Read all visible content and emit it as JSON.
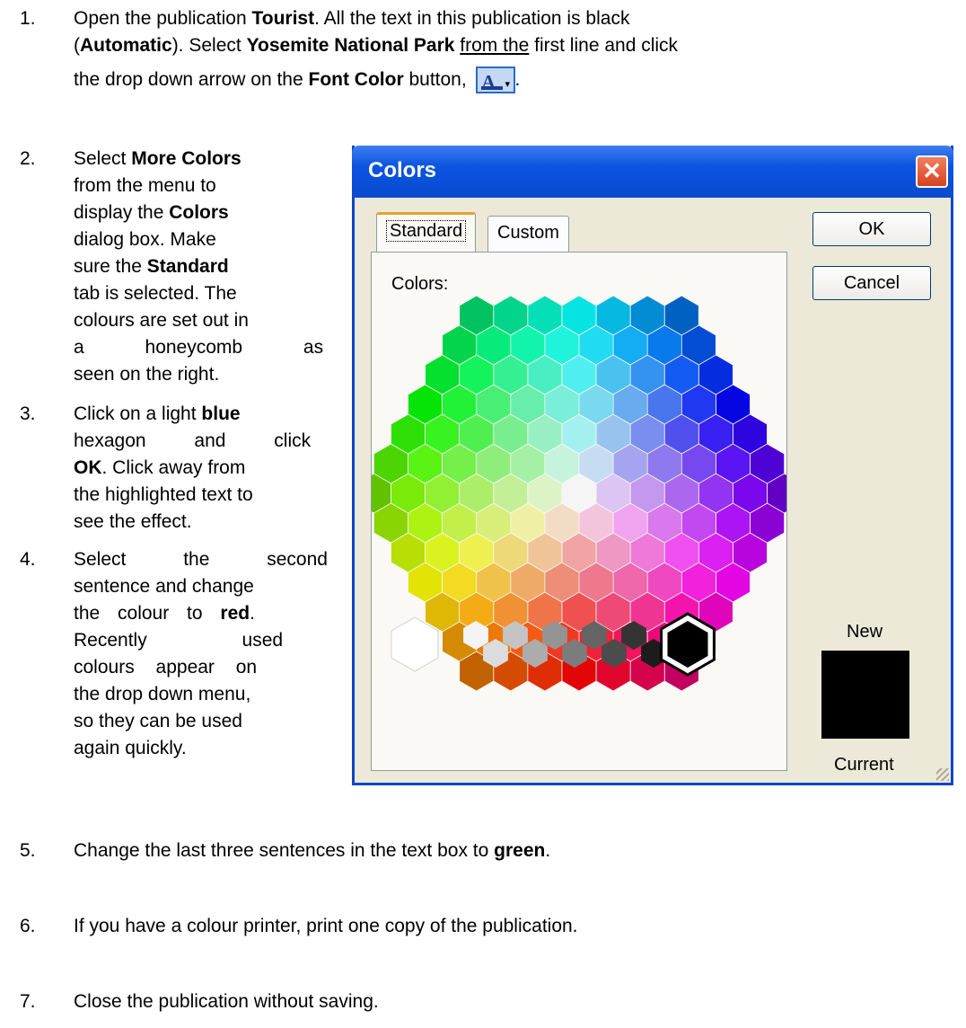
{
  "steps": [
    {
      "num": "1.",
      "line1_pre": "Open the publication ",
      "line1_b1": "Tourist",
      "line1_post": ". All the text in this publication is black",
      "line2_pre": "(",
      "line2_b1": "Automatic",
      "line2_mid": "). Select ",
      "line2_b2": "Yosemite National Park",
      "line2_u": "from the",
      "line2_post": " first line and click",
      "line3_pre": "the drop down arrow on the ",
      "line3_b1": "Font Color",
      "line3_post": " button,",
      "line3_end": "."
    },
    {
      "num": "2.",
      "lines": [
        "Select ",
        "More Colors",
        "from the menu to",
        "display the ",
        "Colors",
        "dialog box. Make",
        "sure the ",
        "Standard",
        "tab is selected. The",
        "colours are set out in",
        "a honeycomb as",
        "seen on the right."
      ]
    },
    {
      "num": "3.",
      "lines": [
        "Click on a light ",
        "blue",
        "hexagon and click",
        "OK",
        ". Click away from",
        "the highlighted text to",
        "see the effect."
      ]
    },
    {
      "num": "4.",
      "lines": [
        "Select the second",
        "sentence and change",
        "the colour to ",
        "red",
        ".",
        "Recently used",
        "colours appear on",
        "the drop down menu,",
        "so they can be used",
        "again quickly."
      ]
    },
    {
      "num": "5.",
      "pre": "Change the last three sentences in the text box to ",
      "b": "green",
      "post": "."
    },
    {
      "num": "6.",
      "text": "If you have a colour printer, print one copy of the publication."
    },
    {
      "num": "7.",
      "text": "Close the publication without saving."
    }
  ],
  "font_color_button": {
    "glyph": "A",
    "arrow": "▾",
    "icon": "font-color-icon"
  },
  "dialog": {
    "title": "Colors",
    "close_glyph": "✕",
    "tabs": [
      "Standard",
      "Custom"
    ],
    "active_tab": "Standard",
    "colors_label": "Colors:",
    "ok_label": "OK",
    "cancel_label": "Cancel",
    "new_label": "New",
    "current_label": "Current",
    "new_color": "#000000",
    "selected_color": "#000000"
  },
  "colors": {
    "title_bar": "#0b54e0",
    "dialog_bg": "#ece9d8",
    "close": "#d8401e",
    "tab_highlight": "#e8a030"
  }
}
